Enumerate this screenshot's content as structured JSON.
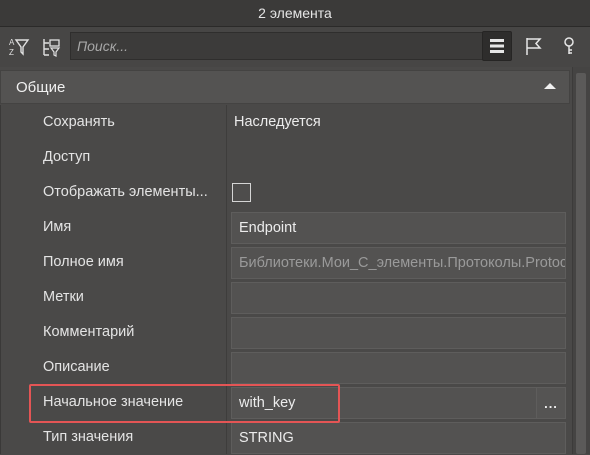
{
  "title": "2 элемента",
  "search": {
    "placeholder": "Поиск..."
  },
  "group": {
    "name": "Общие"
  },
  "properties": [
    {
      "label": "Сохранять",
      "value": "Наследуется",
      "kind": "plain"
    },
    {
      "label": "Доступ",
      "value": "",
      "kind": "plain"
    },
    {
      "label": "Отображать элементы...",
      "value": "",
      "kind": "checkbox"
    },
    {
      "label": "Имя",
      "value": "Endpoint",
      "kind": "field"
    },
    {
      "label": "Полное имя",
      "value": "Библиотеки.Мои_С_элементы.Протоколы.Protoc",
      "kind": "field-dim"
    },
    {
      "label": "Метки",
      "value": "",
      "kind": "field"
    },
    {
      "label": "Комментарий",
      "value": "",
      "kind": "field"
    },
    {
      "label": "Описание",
      "value": "",
      "kind": "field"
    },
    {
      "label": "Начальное значение",
      "value": "with_key",
      "kind": "field-ellipsis",
      "button": "..."
    },
    {
      "label": "Тип значения",
      "value": "STRING",
      "kind": "field"
    }
  ],
  "colors": {
    "highlight": "#e45555",
    "background": "#4a4948"
  },
  "icons": [
    "sort-filter-icon",
    "tree-filter-icon",
    "list-view-icon",
    "flag-icon",
    "key-icon",
    "collapse-up-icon"
  ]
}
